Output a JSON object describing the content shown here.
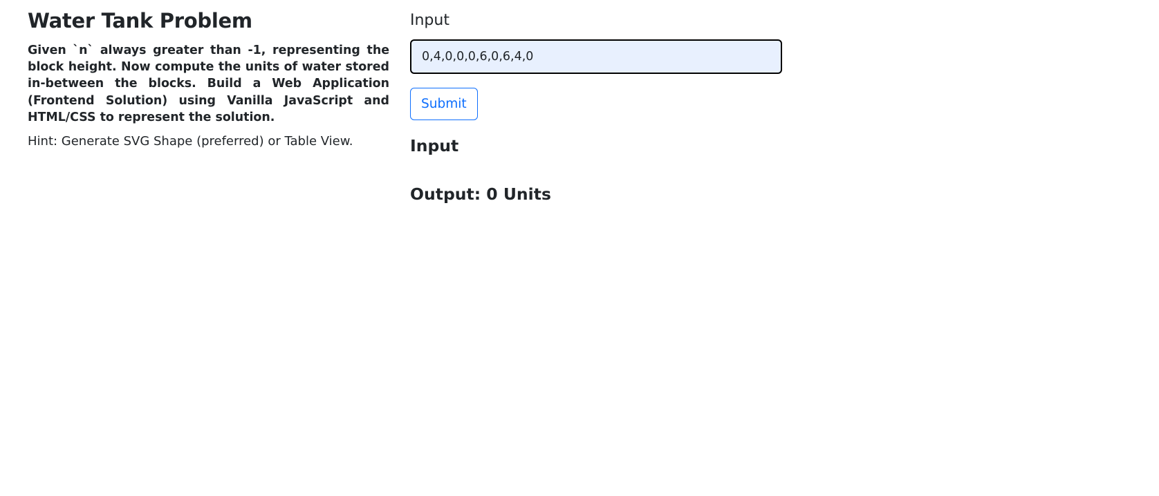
{
  "left": {
    "title": "Water Tank Problem",
    "description": "Given `n` always greater than -1, representing the block height. Now compute the units of water stored in-between the blocks. Build a Web Application (Frontend Solution) using Vanilla JavaScript and HTML/CSS to represent the solution.",
    "hint": "Hint: Generate SVG Shape (preferred) or Table View."
  },
  "form": {
    "input_label": "Input",
    "input_value": "0,4,0,0,0,6,0,6,4,0",
    "submit_label": "Submit"
  },
  "results": {
    "input_heading": "Input",
    "output_text": "Output: 0 Units"
  },
  "colors": {
    "accent": "#0d6efd",
    "input_background": "#e8f0fe",
    "text": "#212529"
  }
}
